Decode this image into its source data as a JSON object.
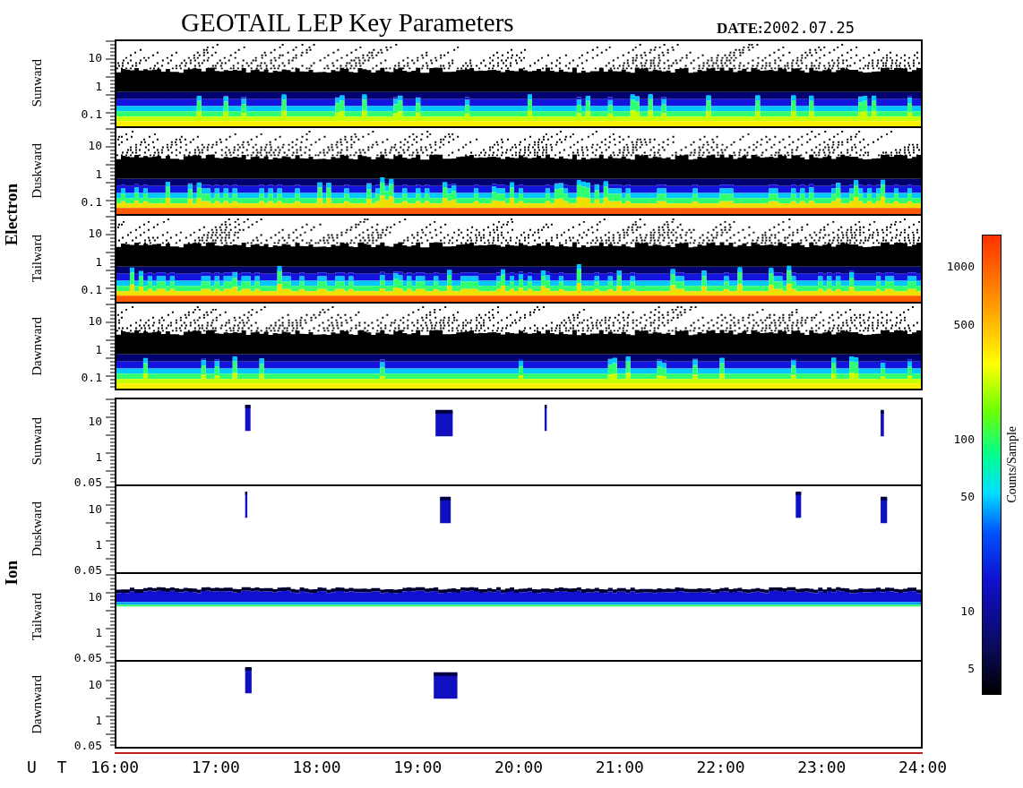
{
  "title": "GEOTAIL LEP Key Parameters",
  "date": {
    "label": "DATE:",
    "value": "2002.07.25"
  },
  "groups": [
    {
      "name": "Electron",
      "panels": [
        {
          "direction": "Sunward",
          "kind": "dense",
          "yticks": [
            "10",
            "1",
            "0.1"
          ]
        },
        {
          "direction": "Duskward",
          "kind": "dense",
          "yticks": [
            "10",
            "1",
            "0.1"
          ]
        },
        {
          "direction": "Tailward",
          "kind": "dense",
          "yticks": [
            "10",
            "1",
            "0.1"
          ]
        },
        {
          "direction": "Dawnward",
          "kind": "dense",
          "yticks": [
            "10",
            "1",
            "0.1"
          ]
        }
      ]
    },
    {
      "name": "Ion",
      "panels": [
        {
          "direction": "Sunward",
          "kind": "sparse",
          "yticks": [
            "10",
            "1",
            "0.05"
          ]
        },
        {
          "direction": "Duskward",
          "kind": "sparse",
          "yticks": [
            "10",
            "1",
            "0.05"
          ]
        },
        {
          "direction": "Tailward",
          "kind": "band",
          "yticks": [
            "10",
            "1",
            "0.05"
          ]
        },
        {
          "direction": "Dawnward",
          "kind": "sparse",
          "yticks": [
            "10",
            "1",
            "0.05"
          ]
        }
      ]
    }
  ],
  "xaxis": {
    "label": "U T",
    "ticks": [
      "16:00",
      "17:00",
      "18:00",
      "19:00",
      "20:00",
      "21:00",
      "22:00",
      "23:00",
      "24:00"
    ]
  },
  "colorbar": {
    "label": "Counts/Sample",
    "ticks": [
      "1000",
      "500",
      "100",
      "50",
      "10",
      "5"
    ]
  }
}
